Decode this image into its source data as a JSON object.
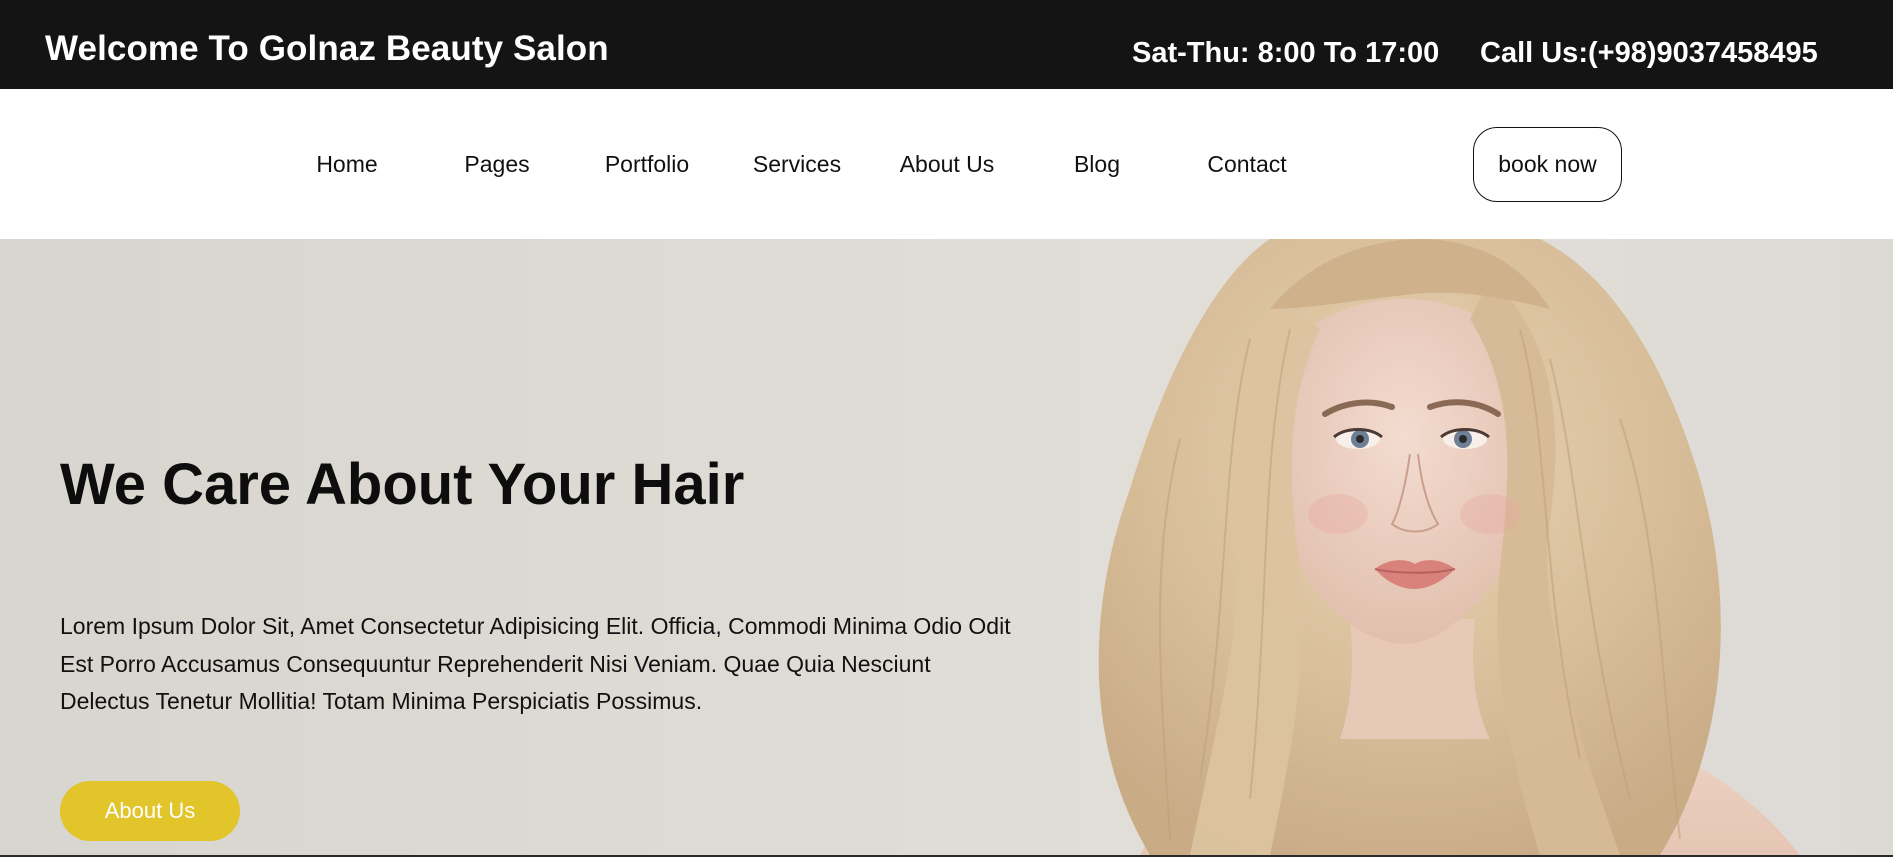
{
  "topbar": {
    "welcome": "Welcome To Golnaz Beauty Salon",
    "hours": "Sat-Thu: 8:00 To 17:00",
    "phone": "Call Us:(+98)9037458495"
  },
  "nav": {
    "items": [
      {
        "label": "Home"
      },
      {
        "label": "Pages"
      },
      {
        "label": "Portfolio"
      },
      {
        "label": "Services"
      },
      {
        "label": "About Us"
      },
      {
        "label": "Blog"
      },
      {
        "label": "Contact"
      }
    ],
    "book_label": "book now"
  },
  "hero": {
    "title": "We Care About Your Hair",
    "text": "Lorem Ipsum Dolor Sit, Amet Consectetur Adipisicing Elit. Officia, Commodi Minima Odio Odit Est Porro Accusamus Consequuntur Reprehenderit Nisi Veniam. Quae Quia Nesciunt Delectus Tenetur Mollitia! Totam Minima Perspiciatis Possimus.",
    "button_label": "About Us",
    "image": "woman-blonde-hair-portrait"
  },
  "colors": {
    "topbar_bg": "#141414",
    "accent": "#e2c42b",
    "hero_bg": "#dcd9d3"
  }
}
